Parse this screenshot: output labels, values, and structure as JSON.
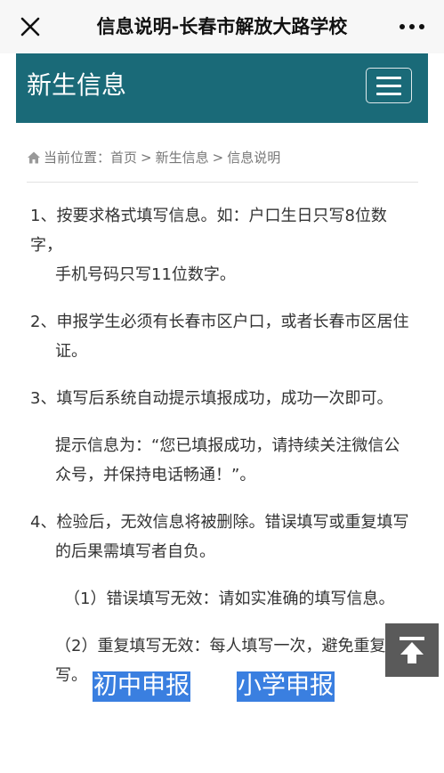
{
  "topbar": {
    "title": "信息说明-长春市解放大路学校"
  },
  "header": {
    "site_title": "新生信息"
  },
  "breadcrumb": {
    "prefix": "当前位置：",
    "home": "首页",
    "sep1": ">",
    "section": "新生信息",
    "sep2": ">",
    "current": "信息说明"
  },
  "content": {
    "item1": "1、按要求格式填写信息。如：户口生日只写8位数字，",
    "item1_cont": "手机号码只写11位数字。",
    "item2": "2、申报学生必须有长春市区户口，或者长春市区居住",
    "item2_cont": "证。",
    "item3": "3、填写后系统自动提示填报成功，成功一次即可。",
    "item3_note": "提示信息为：“您已填报成功，请持续关注微信公",
    "item3_note_cont": "众号，并保持电话畅通！”。",
    "item4": "4、检验后，无效信息将被删除。错误填写或重复填写",
    "item4_cont": "的后果需填写者自负。",
    "item4_sub1": "（1）错误填写无效：请如实准确的填写信息。",
    "item4_sub2": "（2）重复填写无效：每人填写一次，避免重复填",
    "item4_sub2_cont": "写。"
  },
  "links": {
    "junior": "初中申报",
    "primary": "小学申报"
  },
  "icons": {
    "close": "close-icon",
    "more": "more-icon",
    "menu": "menu-icon",
    "home": "home-icon",
    "back_to_top": "back-to-top-icon"
  },
  "colors": {
    "header_bg": "#1a6a78",
    "link_bg": "#3a7fe0",
    "back_top_bg": "#5a5a5a"
  }
}
